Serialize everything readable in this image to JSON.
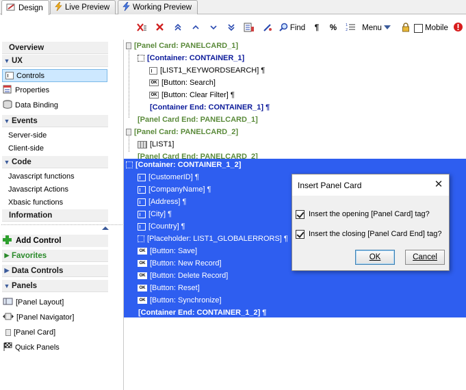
{
  "tabs": [
    {
      "label": "Design",
      "icon": "design-icon",
      "active": true
    },
    {
      "label": "Live Preview",
      "icon": "lightning-icon",
      "active": false
    },
    {
      "label": "Working Preview",
      "icon": "lightning-blue-icon",
      "active": false
    }
  ],
  "toolbar": {
    "find_label": "Find",
    "pilcrow": "¶",
    "percent": "%",
    "menu_label": "Menu",
    "mobile_label": "Mobile",
    "mobile_checked": false
  },
  "left_panel": {
    "overview": "Overview",
    "ux": "UX",
    "controls": "Controls",
    "properties": "Properties",
    "data_binding": "Data Binding",
    "events": "Events",
    "server_side": "Server-side",
    "client_side": "Client-side",
    "code": "Code",
    "js_functions": "Javascript functions",
    "js_actions": "Javascript Actions",
    "xbasic_functions": "Xbasic functions",
    "information": "Information",
    "add_control": "Add Control",
    "favorites": "Favorites",
    "data_controls": "Data Controls",
    "panels": "Panels",
    "panel_layout": "[Panel Layout]",
    "panel_navigator": "[Panel Navigator]",
    "panel_card": "[Panel Card]",
    "quick_panels": "Quick Panels"
  },
  "editor": {
    "l1": "[Panel Card: PANELCARD_1]",
    "l2": "[Container: CONTAINER_1]",
    "l3": "[LIST1_KEYWORDSEARCH] ¶",
    "l4": "[Button: Search]",
    "l5": "[Button: Clear Filter] ¶",
    "l6": "[Container End: CONTAINER_1] ¶",
    "l7": "[Panel Card End: PANELCARD_1]",
    "l8": "[Panel Card: PANELCARD_2]",
    "l9": "[LIST1]",
    "l10": "[Panel Card End: PANELCARD_2]",
    "l11": "[Container: CONTAINER_1_2]",
    "l12": "[CustomerID] ¶",
    "l13": "[CompanyName] ¶",
    "l14": "[Address] ¶",
    "l15": "[City] ¶",
    "l16": "[Country] ¶",
    "l17": "[Placeholder: LIST1_GLOBALERRORS] ¶",
    "l18": "[Button: Save]",
    "l19": "[Button: New Record]",
    "l20": "[Button: Delete Record]",
    "l21": "[Button: Reset]",
    "l22": "[Button: Synchronize]",
    "l23": "[Container End: CONTAINER_1_2] ¶",
    "ok_icon_text": "OK"
  },
  "dialog": {
    "title": "Insert Panel Card",
    "close": "✕",
    "opt1": "Insert the opening [Panel Card] tag?",
    "opt1_checked": true,
    "opt2": "Insert the closing [Panel Card End] tag?",
    "opt2_checked": true,
    "ok": "OK",
    "cancel": "Cancel"
  },
  "colors": {
    "selection": "#2e5ef0",
    "panel_card_text": "#5a8a3a",
    "container_text": "#0b1a9a",
    "favorites": "#2a8a2a"
  }
}
